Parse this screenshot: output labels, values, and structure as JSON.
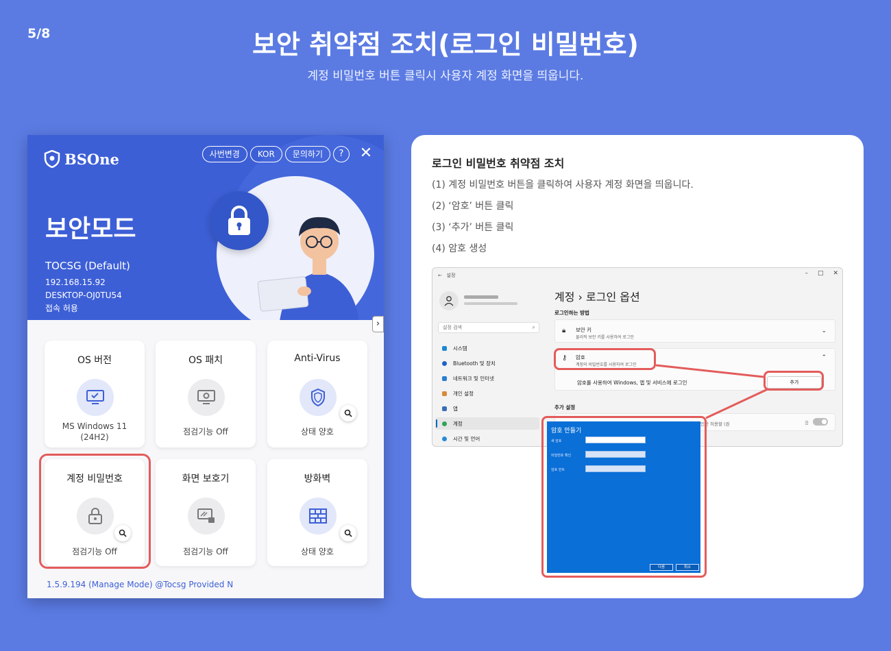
{
  "page": {
    "number": "5/8",
    "title": "보안 취약점 조치(로그인 비밀번호)",
    "subtitle": "계정 비밀번호 버튼 클릭시 사용자 계정 화면을 띄웁니다."
  },
  "app": {
    "logo": "BSOne",
    "header_buttons": [
      "사번변경",
      "KOR",
      "문의하기"
    ],
    "help_label": "?",
    "close_label": "✕",
    "mode_title": "보안모드",
    "profile": "TOCSG (Default)",
    "ip": "192.168.15.92",
    "host": "DESKTOP-OJ0TU54",
    "access": "접속 허용",
    "expand_label": "›",
    "cards": [
      {
        "title": "OS 버전",
        "status": "MS Windows 11",
        "status2": "(24H2)"
      },
      {
        "title": "OS 패치",
        "status": "점검기능 Off"
      },
      {
        "title": "Anti-Virus",
        "status": "상태 양호"
      },
      {
        "title": "계정 비밀번호",
        "status": "점검기능 Off"
      },
      {
        "title": "화면 보호기",
        "status": "점검기능 Off"
      },
      {
        "title": "방화벽",
        "status": "상태 양호"
      }
    ],
    "version": "1.5.9.194 (Manage Mode) @Tocsg Provided N"
  },
  "panel": {
    "heading": "로그인 비밀번호 취약점 조치",
    "steps": [
      "(1) 계정 비밀번호 버튼을 클릭하여 사용자 계정 화면을 띄웁니다.",
      "(2) ‘암호’ 버튼 클릭",
      "(3) ‘추가’ 버튼 클릭",
      "(4) 암호 생성"
    ]
  },
  "settings": {
    "window_title": "설정",
    "controls": [
      "–",
      "□",
      "✕"
    ],
    "search_placeholder": "설정 검색",
    "nav": [
      "시스템",
      "Bluetooth 및 장치",
      "네트워크 및 인터넷",
      "개인 설정",
      "앱",
      "계정",
      "시간 및 언어"
    ],
    "breadcrumb": "계정  ›  로그인 옵션",
    "section1": "로그인하는 방법",
    "security_key": {
      "name": "보안 키",
      "desc": "물리적 보안 키를 사용하여 로그인"
    },
    "password": {
      "name": "암호",
      "desc": "계정의 비밀번호를 사용하여 로그인"
    },
    "password_expand": "암호를 사용하여 Windows, 앱 및 서비스에 로그인",
    "add_label": "추가",
    "section2": "추가 설정",
    "extra_text": "로그인만 허용할 (권",
    "toggle_label": "끔"
  },
  "dialog": {
    "title": "암호 만들기",
    "fields": [
      "새 암호",
      "비밀번호 확인",
      "암호 힌트"
    ],
    "next": "다음",
    "cancel": "취소"
  },
  "colors": {
    "background": "#5b7be3",
    "header_blue": "#3d5fd6",
    "highlight_red": "#e45b5b",
    "dialog_blue": "#0a6fd6"
  }
}
